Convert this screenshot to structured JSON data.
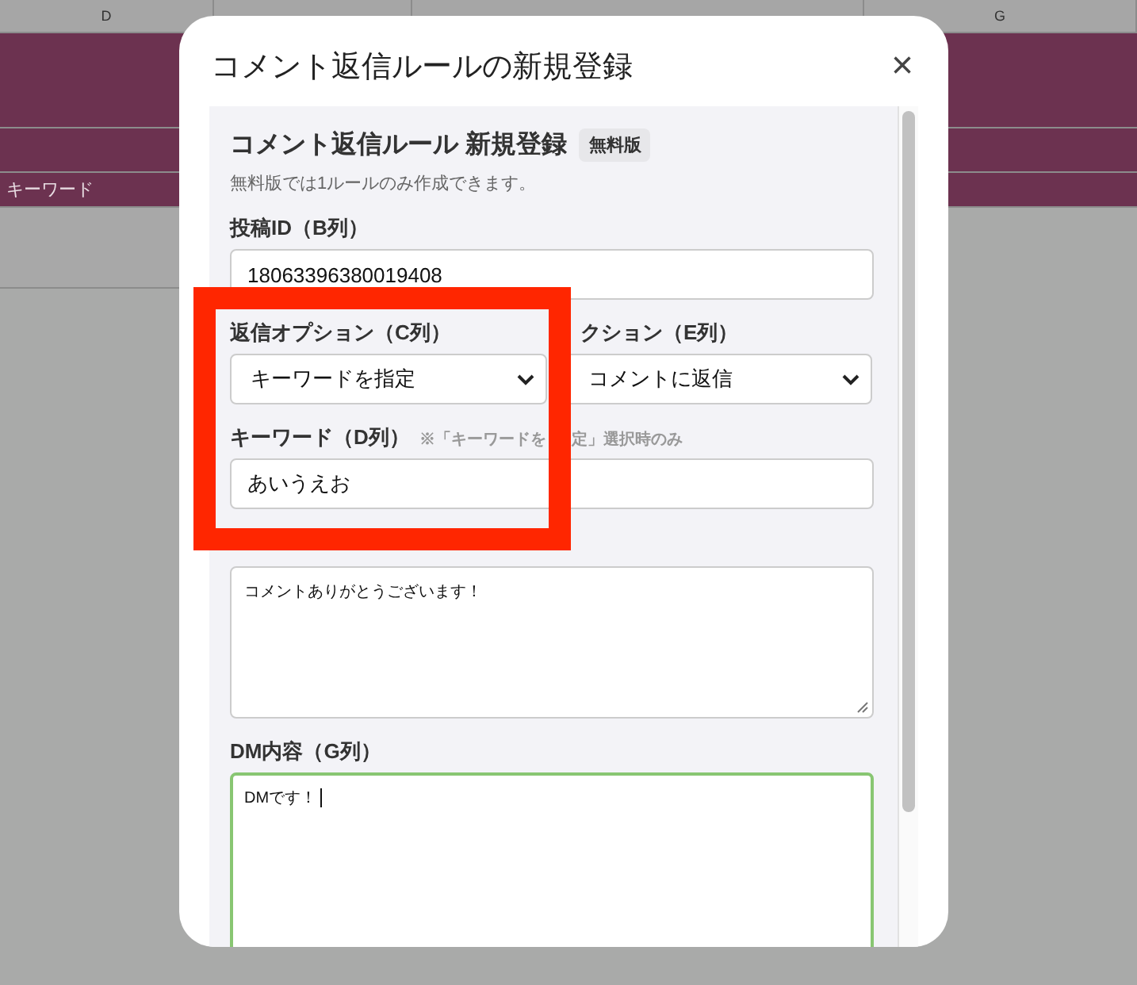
{
  "sheet": {
    "columns": [
      {
        "kind": "labeled",
        "label": "D"
      },
      {
        "kind": "hidden"
      },
      {
        "kind": "hidden"
      },
      {
        "kind": "labeled",
        "label": "G"
      }
    ],
    "rows": [
      {
        "color": "#6c3250"
      },
      {
        "color": "#6c3250"
      },
      {
        "color": "#6c3250",
        "text": "キーワード"
      },
      {
        "color": "#a8a8a8"
      }
    ]
  },
  "modal": {
    "title": "コメント返信ルールの新規登録",
    "close": "×",
    "heading": "コメント返信ルール 新規登録",
    "badge": "無料版",
    "note": "無料版では1ルールのみ作成できます。",
    "fields": [
      {
        "kind": "input",
        "label": "投稿ID（B列）",
        "value": "18063396380019408"
      },
      {
        "kind": "pair",
        "items": [
          {
            "label": "返信オプション（C列）",
            "value": "キーワードを指定"
          },
          {
            "label": "クション（E列）",
            "value": "コメントに返信"
          }
        ]
      },
      {
        "kind": "input",
        "label": "キーワード（D列）",
        "hint": [
          "※「キーワードを",
          "定」選択時のみ"
        ],
        "value": "あいうえお"
      },
      {
        "kind": "textarea",
        "value": "コメントありがとうございます！",
        "focused": false
      },
      {
        "kind": "textarea",
        "label": "DM内容（G列）",
        "value": "DMです！",
        "focused": true
      }
    ]
  },
  "annotation": {
    "kind": "frame"
  }
}
